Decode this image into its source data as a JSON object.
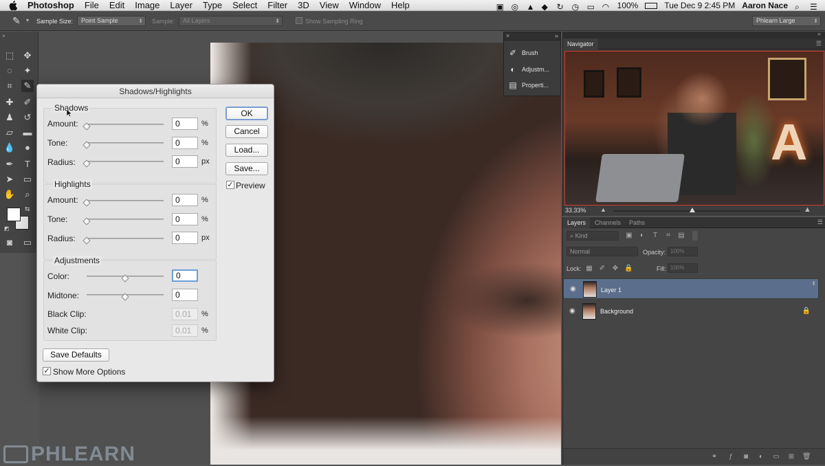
{
  "menubar": {
    "app": "Photoshop",
    "items": [
      "File",
      "Edit",
      "Image",
      "Layer",
      "Type",
      "Select",
      "Filter",
      "3D",
      "View",
      "Window",
      "Help"
    ],
    "battery": "100%",
    "datetime": "Tue Dec 9  2:45 PM",
    "user": "Aaron Nace"
  },
  "options": {
    "sample_size_label": "Sample Size:",
    "sample_size_value": "Point Sample",
    "sample_label": "Sample:",
    "sample_value": "All Layers",
    "sampling_ring_label": "Show Sampling Ring",
    "workspace": "Phlearn Large"
  },
  "dialog": {
    "title": "Shadows/Highlights",
    "shadows": {
      "heading": "Shadows",
      "amount_label": "Amount:",
      "amount": "0",
      "amount_unit": "%",
      "amount_level": 0,
      "tone_label": "Tone:",
      "tone": "0",
      "tone_unit": "%",
      "tone_level": 0,
      "radius_label": "Radius:",
      "radius": "0",
      "radius_unit": "px",
      "radius_level": 0
    },
    "highlights": {
      "heading": "Highlights",
      "amount_label": "Amount:",
      "amount": "0",
      "amount_unit": "%",
      "amount_level": 0,
      "tone_label": "Tone:",
      "tone": "0",
      "tone_unit": "%",
      "tone_level": 0,
      "radius_label": "Radius:",
      "radius": "0",
      "radius_unit": "px",
      "radius_level": 0
    },
    "adjustments": {
      "heading": "Adjustments",
      "color_label": "Color:",
      "color": "0",
      "color_level": 0.5,
      "midtone_label": "Midtone:",
      "midtone": "0",
      "midtone_level": 0.5,
      "black_clip_label": "Black Clip:",
      "black_clip": "0.01",
      "black_clip_unit": "%",
      "white_clip_label": "White Clip:",
      "white_clip": "0.01",
      "white_clip_unit": "%"
    },
    "buttons": {
      "ok": "OK",
      "cancel": "Cancel",
      "load": "Load...",
      "save": "Save..."
    },
    "preview_label": "Preview",
    "preview_checked": true,
    "save_defaults": "Save Defaults",
    "more_options_label": "Show More Options",
    "more_options_checked": true
  },
  "mini_panel": {
    "items": [
      "Brush",
      "Adjustm...",
      "Properti..."
    ]
  },
  "navigator": {
    "tab": "Navigator",
    "zoom": "33.33%"
  },
  "layers": {
    "tabs": [
      "Layers",
      "Channels",
      "Paths"
    ],
    "kind": "Kind",
    "blend_mode": "Normal",
    "opacity_label": "Opacity:",
    "opacity_value": "100%",
    "lock_label": "Lock:",
    "fill_label": "Fill:",
    "fill_value": "100%",
    "rows": [
      {
        "name": "Layer 1",
        "selected": true
      },
      {
        "name": "Background",
        "selected": false
      }
    ]
  },
  "watermark": "PHLEARN",
  "colors": {
    "selection": "#5b6f8c",
    "dialog_bg": "#e8e8e8",
    "accent_focus": "#6c9ed8"
  }
}
